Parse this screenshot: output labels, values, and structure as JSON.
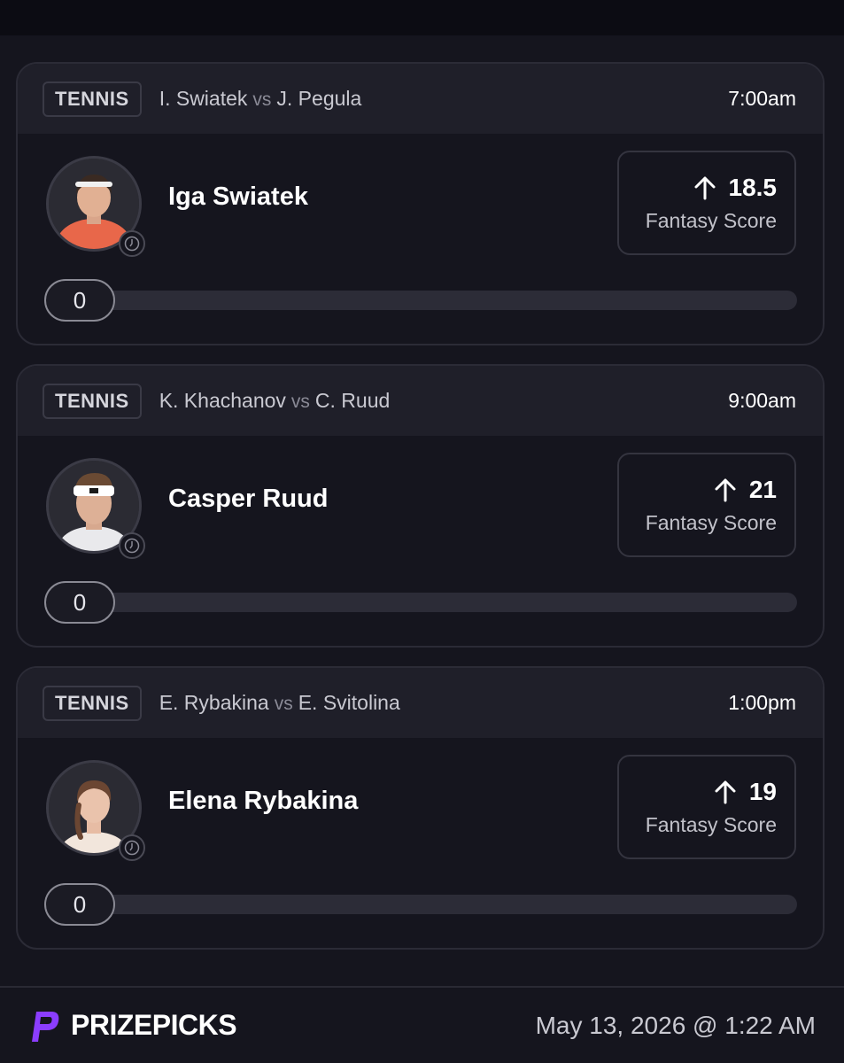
{
  "colors": {
    "background": "#15151e",
    "header": "#1f1f29",
    "accent": "#8b3dff"
  },
  "picks": [
    {
      "sport": "TENNIS",
      "player_a": "I. Swiatek",
      "vs": "vs",
      "player_b": "J. Pegula",
      "time": "7:00am",
      "player_name": "Iga Swiatek",
      "direction_icon": "arrow-up-icon",
      "line": "18.5",
      "stat": "Fantasy Score",
      "current": "0",
      "progress_fraction": 0
    },
    {
      "sport": "TENNIS",
      "player_a": "K. Khachanov",
      "vs": "vs",
      "player_b": "C. Ruud",
      "time": "9:00am",
      "player_name": "Casper Ruud",
      "direction_icon": "arrow-up-icon",
      "line": "21",
      "stat": "Fantasy Score",
      "current": "0",
      "progress_fraction": 0
    },
    {
      "sport": "TENNIS",
      "player_a": "E. Rybakina",
      "vs": "vs",
      "player_b": "E. Svitolina",
      "time": "1:00pm",
      "player_name": "Elena Rybakina",
      "direction_icon": "arrow-up-icon",
      "line": "19",
      "stat": "Fantasy Score",
      "current": "0",
      "progress_fraction": 0
    }
  ],
  "footer": {
    "brand": "PRIZEPICKS",
    "timestamp": "May 13, 2026 @ 1:22 AM"
  }
}
